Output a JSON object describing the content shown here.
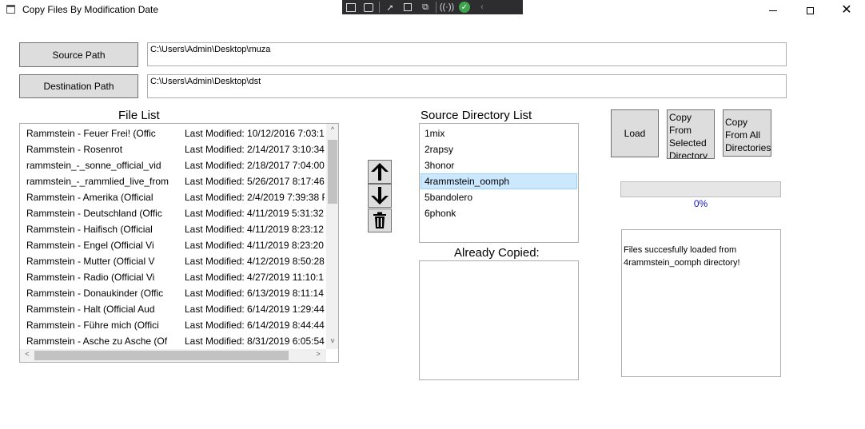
{
  "window": {
    "title": "Copy Files By Modification Date",
    "controls": {
      "minimize": "minimize-icon",
      "maximize": "maximize-icon",
      "close": "close-icon"
    }
  },
  "debug_toolbar": {
    "icons": [
      "select-element-icon",
      "record-icon",
      "pointer-icon",
      "frame-icon",
      "hot-reload-icon",
      "binding-icon",
      "check-icon",
      "collapse-icon"
    ]
  },
  "paths": {
    "source_button": "Source Path",
    "source_value": "C:\\Users\\Admin\\Desktop\\muza",
    "destination_button": "Destination Path",
    "destination_value": "C:\\Users\\Admin\\Desktop\\dst"
  },
  "file_list": {
    "label": "File List",
    "rows": [
      {
        "name": "Rammstein - Feuer Frei! (Offic",
        "modified": "Last Modified: 10/12/2016 7:03:1"
      },
      {
        "name": "Rammstein - Rosenrot",
        "modified": "Last Modified: 2/14/2017 3:10:34"
      },
      {
        "name": "rammstein_-_sonne_official_vid",
        "modified": "Last Modified: 2/18/2017 7:04:00"
      },
      {
        "name": "rammstein_-_rammlied_live_from",
        "modified": "Last Modified: 5/26/2017 8:17:46"
      },
      {
        "name": "Rammstein - Amerika (Official",
        "modified": "Last Modified: 2/4/2019 7:39:38 P"
      },
      {
        "name": "Rammstein - Deutschland (Offic",
        "modified": "Last Modified: 4/11/2019 5:31:32"
      },
      {
        "name": "Rammstein - Haifisch (Official",
        "modified": "Last Modified: 4/11/2019 8:23:12"
      },
      {
        "name": "Rammstein - Engel (Official Vi",
        "modified": "Last Modified: 4/11/2019 8:23:20"
      },
      {
        "name": "Rammstein - Mutter (Official V",
        "modified": "Last Modified: 4/12/2019 8:50:28"
      },
      {
        "name": "Rammstein - Radio (Official Vi",
        "modified": "Last Modified: 4/27/2019 11:10:1"
      },
      {
        "name": "Rammstein - Donaukinder (Offic",
        "modified": "Last Modified: 6/13/2019 8:11:14"
      },
      {
        "name": "Rammstein - Halt (Official Aud",
        "modified": "Last Modified: 6/14/2019 1:29:44"
      },
      {
        "name": "Rammstein - Führe mich (Offici",
        "modified": "Last Modified: 6/14/2019 8:44:44"
      },
      {
        "name": "Rammstein - Asche zu Asche (Of",
        "modified": "Last Modified: 8/31/2019 6:05:54"
      }
    ]
  },
  "reorder_buttons": {
    "up": "arrow-up-icon",
    "down": "arrow-down-icon",
    "delete": "trash-icon"
  },
  "directory_list": {
    "label": "Source Directory List",
    "items": [
      "1mix",
      "2rapsy",
      "3honor",
      "4rammstein_oomph",
      "5bandolero",
      "6phonk"
    ],
    "selected": "4rammstein_oomph"
  },
  "already_copied": {
    "label": "Already Copied:"
  },
  "actions": {
    "load": "Load",
    "copy_selected": "Copy From Selected Directory",
    "copy_all": "Copy From All Directories"
  },
  "progress": {
    "value": 0,
    "text": "0%"
  },
  "status": {
    "message": "Files succesfully loaded from 4rammstein_oomph directory!"
  }
}
